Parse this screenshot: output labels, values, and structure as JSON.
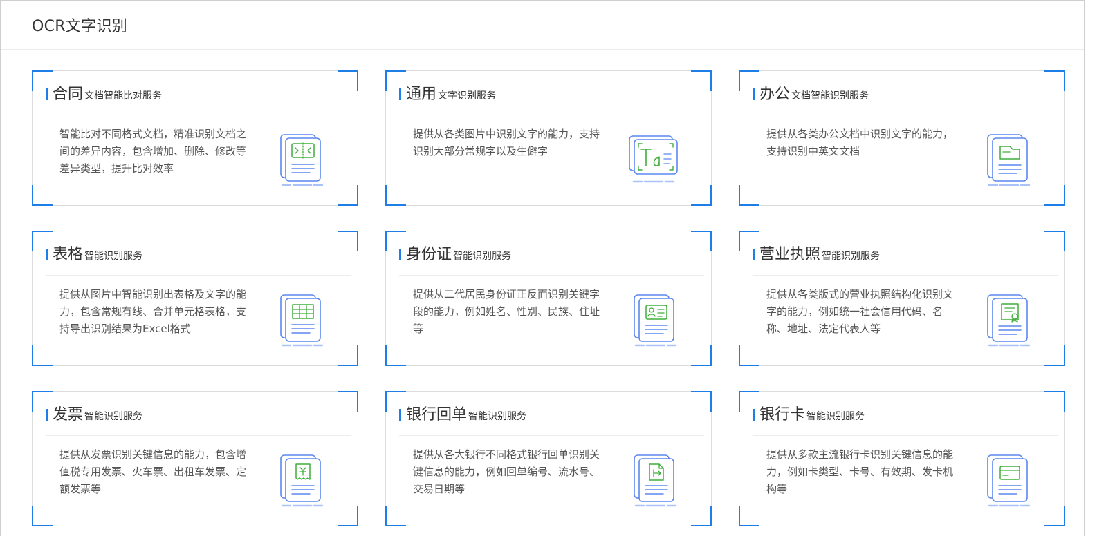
{
  "page": {
    "title": "OCR文字识别"
  },
  "cards": [
    {
      "title": "合同",
      "subtitle": "文档智能比对服务",
      "desc": "智能比对不同格式文档，精准识别文档之间的差异内容，包含增加、删除、修改等差异类型，提升比对效率",
      "icon": "document-compare-icon"
    },
    {
      "title": "通用",
      "subtitle": "文字识别服务",
      "desc": "提供从各类图片中识别文字的能力，支持识别大部分常规字以及生僻字",
      "icon": "text-recognition-icon"
    },
    {
      "title": "办公",
      "subtitle": "文档智能识别服务",
      "desc": "提供从各类办公文档中识别文字的能力，支持识别中英文文档",
      "icon": "office-document-icon"
    },
    {
      "title": "表格",
      "subtitle": "智能识别服务",
      "desc": "提供从图片中智能识别出表格及文字的能力，包含常规有线、合并单元格表格，支持导出识别结果为Excel格式",
      "icon": "table-icon"
    },
    {
      "title": "身份证",
      "subtitle": "智能识别服务",
      "desc": "提供从二代居民身份证正反面识别关键字段的能力，例如姓名、性别、民族、住址等",
      "icon": "id-card-icon"
    },
    {
      "title": "营业执照",
      "subtitle": "智能识别服务",
      "desc": "提供从各类版式的营业执照结构化识别文字的能力，例如统一社会信用代码、名称、地址、法定代表人等",
      "icon": "business-license-icon"
    },
    {
      "title": "发票",
      "subtitle": "智能识别服务",
      "desc": "提供从发票识别关键信息的能力，包含增值税专用发票、火车票、出租车发票、定额发票等",
      "icon": "invoice-icon"
    },
    {
      "title": "银行回单",
      "subtitle": "智能识别服务",
      "desc": "提供从各大银行不同格式银行回单识别关键信息的能力，例如回单编号、流水号、交易日期等",
      "icon": "bank-receipt-icon"
    },
    {
      "title": "银行卡",
      "subtitle": "智能识别服务",
      "desc": "提供从多款主流银行卡识别关键信息的能力，例如卡类型、卡号、有效期、发卡机构等",
      "icon": "bank-card-icon"
    }
  ],
  "colors": {
    "accent": "#1e7ee8",
    "icon_outline": "#5b86f0",
    "icon_detail": "#3fae3b",
    "border": "#dcdcdc"
  }
}
